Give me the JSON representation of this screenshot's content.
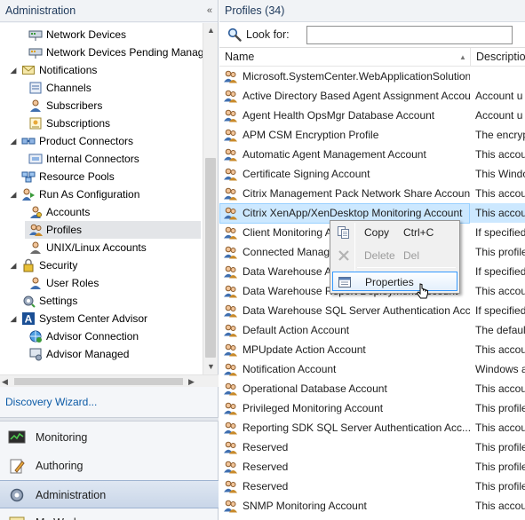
{
  "left_pane": {
    "title": "Administration",
    "collapse_glyph": "«",
    "tree": [
      {
        "label": "Network Devices",
        "icon": "network-device-icon",
        "indent": 2,
        "expander": ""
      },
      {
        "label": "Network Devices Pending Management",
        "icon": "network-device-pending-icon",
        "indent": 2,
        "expander": ""
      },
      {
        "label": "Notifications",
        "icon": "envelope-icon",
        "indent": 1,
        "expander": "◢"
      },
      {
        "label": "Channels",
        "icon": "channel-icon",
        "indent": 2,
        "expander": ""
      },
      {
        "label": "Subscribers",
        "icon": "subscriber-icon",
        "indent": 2,
        "expander": ""
      },
      {
        "label": "Subscriptions",
        "icon": "subscription-icon",
        "indent": 2,
        "expander": ""
      },
      {
        "label": "Product Connectors",
        "icon": "connector-icon",
        "indent": 1,
        "expander": "◢"
      },
      {
        "label": "Internal Connectors",
        "icon": "internal-connector-icon",
        "indent": 2,
        "expander": ""
      },
      {
        "label": "Resource Pools",
        "icon": "resource-pool-icon",
        "indent": 1,
        "expander": ""
      },
      {
        "label": "Run As Configuration",
        "icon": "run-as-icon",
        "indent": 1,
        "expander": "◢"
      },
      {
        "label": "Accounts",
        "icon": "account-icon",
        "indent": 2,
        "expander": ""
      },
      {
        "label": "Profiles",
        "icon": "profile-icon",
        "indent": 2,
        "expander": "",
        "selected": true
      },
      {
        "label": "UNIX/Linux Accounts",
        "icon": "unix-account-icon",
        "indent": 2,
        "expander": ""
      },
      {
        "label": "Security",
        "icon": "lock-icon",
        "indent": 1,
        "expander": "◢"
      },
      {
        "label": "User Roles",
        "icon": "user-role-icon",
        "indent": 2,
        "expander": ""
      },
      {
        "label": "Settings",
        "icon": "settings-icon",
        "indent": 1,
        "expander": ""
      },
      {
        "label": "System Center Advisor",
        "icon": "advisor-icon",
        "indent": 1,
        "expander": "◢"
      },
      {
        "label": "Advisor Connection",
        "icon": "advisor-connection-icon",
        "indent": 2,
        "expander": ""
      },
      {
        "label": "Advisor Managed",
        "icon": "advisor-managed-icon",
        "indent": 2,
        "expander": ""
      }
    ],
    "discovery_link": "Discovery Wizard...",
    "wunderbar": [
      {
        "label": "Monitoring",
        "icon": "monitoring-icon"
      },
      {
        "label": "Authoring",
        "icon": "authoring-icon"
      },
      {
        "label": "Administration",
        "icon": "administration-icon",
        "active": true
      },
      {
        "label": "My Workspace",
        "icon": "my-workspace-icon"
      }
    ]
  },
  "right_pane": {
    "title": "Profiles (34)",
    "look_for_label": "Look for:",
    "look_for_value": "",
    "columns": {
      "name": "Name",
      "description": "Description"
    },
    "rows": [
      {
        "name": "Microsoft.SystemCenter.WebApplicationSolutions...",
        "description": ""
      },
      {
        "name": "Active Directory Based Agent Assignment Account",
        "description": "Account u"
      },
      {
        "name": "Agent Health OpsMgr Database Account",
        "description": "Account u"
      },
      {
        "name": "APM CSM Encryption Profile",
        "description": "The encryp"
      },
      {
        "name": "Automatic Agent Management Account",
        "description": "This accou"
      },
      {
        "name": "Certificate Signing Account",
        "description": "This Windo"
      },
      {
        "name": "Citrix Management Pack Network Share Account",
        "description": "This accou"
      },
      {
        "name": "Citrix XenApp/XenDesktop Monitoring Account",
        "description": "This accou",
        "selected": true
      },
      {
        "name": "Client Monitoring Action Account",
        "description": "If specified"
      },
      {
        "name": "Connected Management Group Account",
        "description": "This profile"
      },
      {
        "name": "Data Warehouse Account",
        "description": "If specified"
      },
      {
        "name": "Data Warehouse Report Deployment Account",
        "description": "This accou"
      },
      {
        "name": "Data Warehouse SQL Server Authentication Acc...",
        "description": "If specified"
      },
      {
        "name": "Default Action Account",
        "description": "The defaul"
      },
      {
        "name": "MPUpdate Action Account",
        "description": "This accou"
      },
      {
        "name": "Notification Account",
        "description": "Windows a"
      },
      {
        "name": "Operational Database Account",
        "description": "This accou"
      },
      {
        "name": "Privileged Monitoring Account",
        "description": "This profile"
      },
      {
        "name": "Reporting SDK SQL Server Authentication Acc...",
        "description": "This accou"
      },
      {
        "name": "Reserved",
        "description": "This profile"
      },
      {
        "name": "Reserved",
        "description": "This profile"
      },
      {
        "name": "Reserved",
        "description": "This profile"
      },
      {
        "name": "SNMP Monitoring Account",
        "description": "This accou"
      }
    ]
  },
  "context_menu": {
    "items": [
      {
        "label": "Copy",
        "shortcut": "Ctrl+C",
        "icon": "copy-icon",
        "disabled": false
      },
      {
        "label": "Delete",
        "shortcut": "Del",
        "icon": "delete-x-icon",
        "disabled": true
      },
      {
        "label": "Properties",
        "shortcut": "",
        "icon": "properties-icon",
        "disabled": false,
        "hover": true
      }
    ]
  },
  "colors": {
    "selection": "#cce8ff",
    "link": "#0b5aa6",
    "header_text": "#1e395b"
  }
}
